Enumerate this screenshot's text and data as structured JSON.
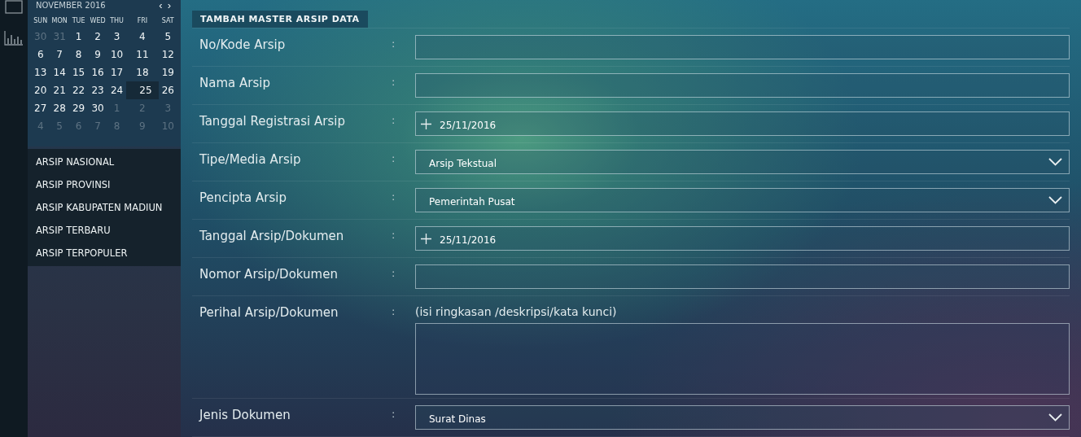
{
  "calendar": {
    "month": "NOVEMBER 2016",
    "prev": "‹",
    "next": "›",
    "weekdays": [
      "SUN",
      "MON",
      "TUE",
      "WED",
      "THU",
      "FRI",
      "SAT"
    ],
    "weeks": [
      [
        {
          "day": "30",
          "muted": true,
          "selected": false
        },
        {
          "day": "31",
          "muted": true,
          "selected": false
        },
        {
          "day": "1",
          "muted": false,
          "selected": false
        },
        {
          "day": "2",
          "muted": false,
          "selected": false
        },
        {
          "day": "3",
          "muted": false,
          "selected": false
        },
        {
          "day": "4",
          "muted": false,
          "selected": false
        },
        {
          "day": "5",
          "muted": false,
          "selected": false
        }
      ],
      [
        {
          "day": "6",
          "muted": false,
          "selected": false
        },
        {
          "day": "7",
          "muted": false,
          "selected": false
        },
        {
          "day": "8",
          "muted": false,
          "selected": false
        },
        {
          "day": "9",
          "muted": false,
          "selected": false
        },
        {
          "day": "10",
          "muted": false,
          "selected": false
        },
        {
          "day": "11",
          "muted": false,
          "selected": false
        },
        {
          "day": "12",
          "muted": false,
          "selected": false
        }
      ],
      [
        {
          "day": "13",
          "muted": false,
          "selected": false
        },
        {
          "day": "14",
          "muted": false,
          "selected": false
        },
        {
          "day": "15",
          "muted": false,
          "selected": false
        },
        {
          "day": "16",
          "muted": false,
          "selected": false
        },
        {
          "day": "17",
          "muted": false,
          "selected": false
        },
        {
          "day": "18",
          "muted": false,
          "selected": false
        },
        {
          "day": "19",
          "muted": false,
          "selected": false
        }
      ],
      [
        {
          "day": "20",
          "muted": false,
          "selected": false
        },
        {
          "day": "21",
          "muted": false,
          "selected": false
        },
        {
          "day": "22",
          "muted": false,
          "selected": false
        },
        {
          "day": "23",
          "muted": false,
          "selected": false
        },
        {
          "day": "24",
          "muted": false,
          "selected": false
        },
        {
          "day": "25",
          "muted": false,
          "selected": true
        },
        {
          "day": "26",
          "muted": false,
          "selected": false
        }
      ],
      [
        {
          "day": "27",
          "muted": false,
          "selected": false
        },
        {
          "day": "28",
          "muted": false,
          "selected": false
        },
        {
          "day": "29",
          "muted": false,
          "selected": false
        },
        {
          "day": "30",
          "muted": false,
          "selected": false
        },
        {
          "day": "1",
          "muted": true,
          "selected": false
        },
        {
          "day": "2",
          "muted": true,
          "selected": false
        },
        {
          "day": "3",
          "muted": true,
          "selected": false
        }
      ],
      [
        {
          "day": "4",
          "muted": true,
          "selected": false
        },
        {
          "day": "5",
          "muted": true,
          "selected": false
        },
        {
          "day": "6",
          "muted": true,
          "selected": false
        },
        {
          "day": "7",
          "muted": true,
          "selected": false
        },
        {
          "day": "8",
          "muted": true,
          "selected": false
        },
        {
          "day": "9",
          "muted": true,
          "selected": false
        },
        {
          "day": "10",
          "muted": true,
          "selected": false
        }
      ]
    ]
  },
  "sidebar": {
    "items": [
      "ARSIP NASIONAL",
      "ARSIP PROVINSI",
      "ARSIP KABUPATEN MADIUN",
      "ARSIP TERBARU",
      "ARSIP TERPOPULER"
    ]
  },
  "form": {
    "title": "TAMBAH MASTER ARSIP DATA",
    "fields": [
      {
        "kind": "text",
        "label": "No/Kode Arsip",
        "separator": ":"
      },
      {
        "kind": "text",
        "label": "Nama Arsip",
        "separator": ":"
      },
      {
        "kind": "date",
        "label": "Tanggal Registrasi Arsip",
        "separator": ":",
        "value": "25/11/2016"
      },
      {
        "kind": "select",
        "label": "Tipe/Media Arsip",
        "separator": ":",
        "value": "Arsip Tekstual"
      },
      {
        "kind": "select",
        "label": "Pencipta Arsip",
        "separator": ":",
        "value": "Pemerintah Pusat"
      },
      {
        "kind": "date",
        "label": "Tanggal Arsip/Dokumen",
        "separator": ":",
        "value": "25/11/2016"
      },
      {
        "kind": "text",
        "label": "Nomor Arsip/Dokumen",
        "separator": ":"
      },
      {
        "kind": "textarea",
        "label": "Perihal Arsip/Dokumen",
        "separator": ":",
        "note": "(isi ringkasan /deskripsi/kata kunci)"
      },
      {
        "kind": "select",
        "label": "Jenis Dokumen",
        "separator": ":",
        "value": "Surat Dinas"
      }
    ]
  }
}
